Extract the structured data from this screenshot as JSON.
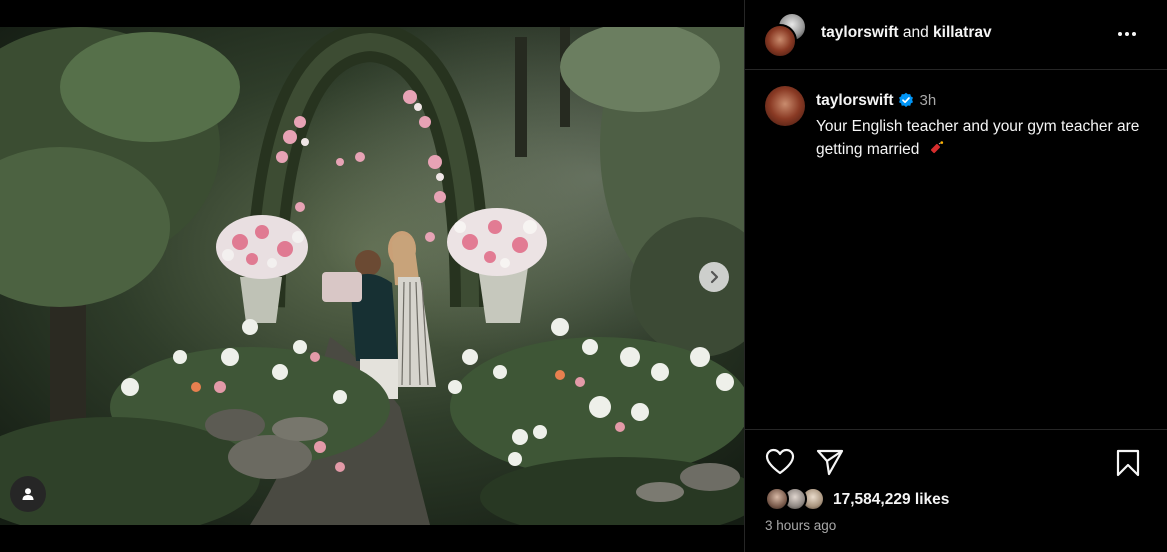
{
  "post": {
    "header": {
      "user1": "taylorswift",
      "joiner": "and",
      "user2": "killatrav"
    },
    "caption": {
      "username": "taylorswift",
      "time": "3h",
      "text": "Your English teacher and your gym teacher are getting married"
    },
    "likes": "17,584,229 likes",
    "posted": "3 hours ago"
  },
  "icons": {
    "verified": "verified-badge-icon",
    "more": "more-options-icon",
    "like": "heart-icon",
    "share": "send-icon",
    "save": "bookmark-icon",
    "next": "chevron-right-icon",
    "tags": "user-tag-icon",
    "emoji": "dynamite-emoji"
  },
  "colors": {
    "background": "#000000",
    "verified": "#0095f6",
    "muted_text": "#a8a8a8",
    "divider": "#262626"
  }
}
